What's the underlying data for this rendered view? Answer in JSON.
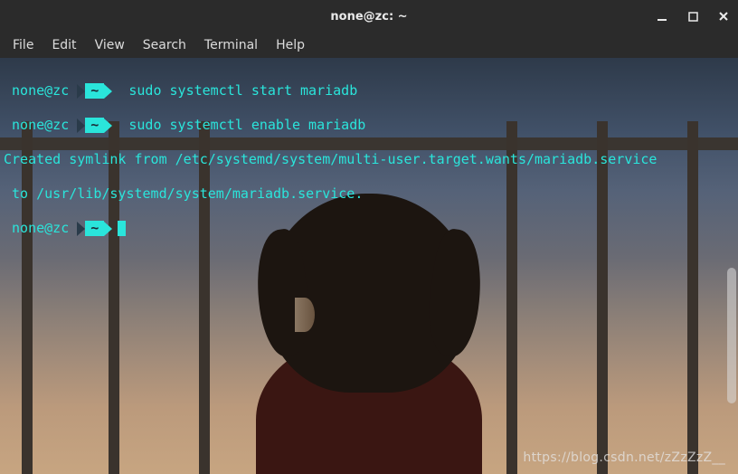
{
  "window": {
    "title": "none@zc: ~"
  },
  "menubar": {
    "items": [
      "File",
      "Edit",
      "View",
      "Search",
      "Terminal",
      "Help"
    ]
  },
  "prompt": {
    "user_host": "none@zc",
    "path": "~"
  },
  "lines": {
    "cmd1": "sudo systemctl start mariadb",
    "cmd2": "sudo systemctl enable mariadb",
    "out1": "Created symlink from /etc/systemd/system/multi-user.target.wants/mariadb.service",
    "out2": " to /usr/lib/systemd/system/mariadb.service."
  },
  "watermark": "https://blog.csdn.net/zZzZzZ__"
}
